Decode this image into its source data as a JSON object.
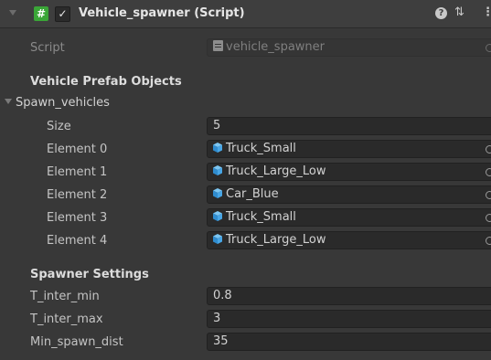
{
  "component": {
    "title": "Vehicle_spawner (Script)",
    "enabled": true,
    "icon": "csharp-script-hash-icon"
  },
  "script_row": {
    "label": "Script",
    "value": "vehicle_spawner"
  },
  "prefab_section": {
    "header": "Vehicle Prefab Objects",
    "list_label": "Spawn_vehicles",
    "size_label": "Size",
    "size_value": "5",
    "elements": [
      {
        "label": "Element 0",
        "value": "Truck_Small"
      },
      {
        "label": "Element 1",
        "value": "Truck_Large_Low"
      },
      {
        "label": "Element 2",
        "value": "Car_Blue"
      },
      {
        "label": "Element 3",
        "value": "Truck_Small"
      },
      {
        "label": "Element 4",
        "value": "Truck_Large_Low"
      }
    ]
  },
  "spawner_section": {
    "header": "Spawner Settings",
    "fields": [
      {
        "label": "T_inter_min",
        "value": "0.8"
      },
      {
        "label": "T_inter_max",
        "value": "3"
      },
      {
        "label": "Min_spawn_dist",
        "value": "35"
      }
    ]
  },
  "colors": {
    "panel_bg": "#383838",
    "field_bg": "#2a2a2a",
    "script_icon_green": "#3aa637",
    "prefab_blue": "#3fa8e8"
  }
}
